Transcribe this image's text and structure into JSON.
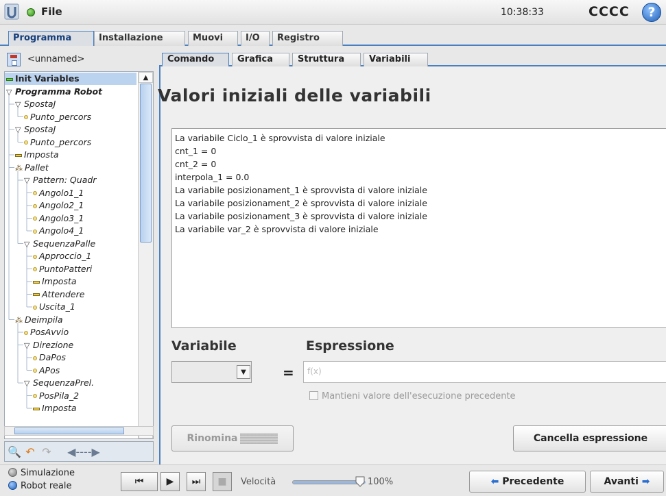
{
  "header": {
    "menu_label": "File",
    "clock": "10:38:33",
    "robot_name": "CCCC",
    "help_symbol": "?",
    "logo_icon": "ur-logo-icon",
    "status_icon": "power-on-icon"
  },
  "main_tabs": [
    "Programma",
    "Installazione",
    "Muovi",
    "I/O",
    "Registro"
  ],
  "program": {
    "name": "<unnamed>"
  },
  "tree": [
    {
      "label": "Init Variables",
      "level": 0,
      "icon": "green-bar"
    },
    {
      "label": "Programma Robot",
      "level": 0,
      "icon": "triangle"
    },
    {
      "label": "SpostaJ",
      "level": 1,
      "icon": "triangle"
    },
    {
      "label": "Punto_percors",
      "level": 2,
      "icon": "dot"
    },
    {
      "label": "SpostaJ",
      "level": 1,
      "icon": "triangle"
    },
    {
      "label": "Punto_percors",
      "level": 2,
      "icon": "dot"
    },
    {
      "label": "Imposta",
      "level": 1,
      "icon": "bar"
    },
    {
      "label": "Pallet",
      "level": 1,
      "icon": "clover"
    },
    {
      "label": "Pattern: Quadr",
      "level": 2,
      "icon": "triangle"
    },
    {
      "label": "Angolo1_1",
      "level": 3,
      "icon": "dot"
    },
    {
      "label": "Angolo2_1",
      "level": 3,
      "icon": "dot"
    },
    {
      "label": "Angolo3_1",
      "level": 3,
      "icon": "dot"
    },
    {
      "label": "Angolo4_1",
      "level": 3,
      "icon": "dot"
    },
    {
      "label": "SequenzaPalle",
      "level": 2,
      "icon": "triangle"
    },
    {
      "label": "Approccio_1",
      "level": 3,
      "icon": "dot"
    },
    {
      "label": "PuntoPatteri",
      "level": 3,
      "icon": "dot"
    },
    {
      "label": "Imposta",
      "level": 3,
      "icon": "bar"
    },
    {
      "label": "Attendere",
      "level": 3,
      "icon": "bar"
    },
    {
      "label": "Uscita_1",
      "level": 3,
      "icon": "dot"
    },
    {
      "label": "Deimpila",
      "level": 1,
      "icon": "clover"
    },
    {
      "label": "PosAvvio",
      "level": 2,
      "icon": "dot"
    },
    {
      "label": "Direzione",
      "level": 2,
      "icon": "triangle"
    },
    {
      "label": "DaPos",
      "level": 3,
      "icon": "dot"
    },
    {
      "label": "APos",
      "level": 3,
      "icon": "dot"
    },
    {
      "label": "SequenzaPrel.",
      "level": 2,
      "icon": "triangle"
    },
    {
      "label": "PosPila_2",
      "level": 3,
      "icon": "dot"
    },
    {
      "label": "Imposta",
      "level": 3,
      "icon": "bar"
    }
  ],
  "sub_tabs": [
    "Comando",
    "Grafica",
    "Struttura",
    "Variabili"
  ],
  "content": {
    "title": "Valori iniziali delle variabili",
    "lines": [
      "La variabile Ciclo_1 è sprovvista di valore iniziale",
      "cnt_1 = 0",
      "cnt_2 = 0",
      "interpola_1 = 0.0",
      "La variabile posizionament_1 è sprovvista di valore iniziale",
      "La variabile posizionament_2 è sprovvista di valore iniziale",
      "La variabile posizionament_3 è sprovvista di valore iniziale",
      "La variabile var_2 è sprovvista di valore iniziale"
    ],
    "variable_label": "Variabile",
    "expression_label": "Espressione",
    "equals": "=",
    "expression_placeholder": "f(x)",
    "keep_label": "Mantieni valore dell'esecuzione precedente",
    "rename_label": "Rinomina",
    "clear_label": "Cancella espressione"
  },
  "footer": {
    "sim_label": "Simulazione",
    "real_label": "Robot reale",
    "speed_label": "Velocità",
    "speed_value": "100%",
    "speed_fraction": 1.0,
    "prev_label": "Precedente",
    "next_label": "Avanti"
  }
}
